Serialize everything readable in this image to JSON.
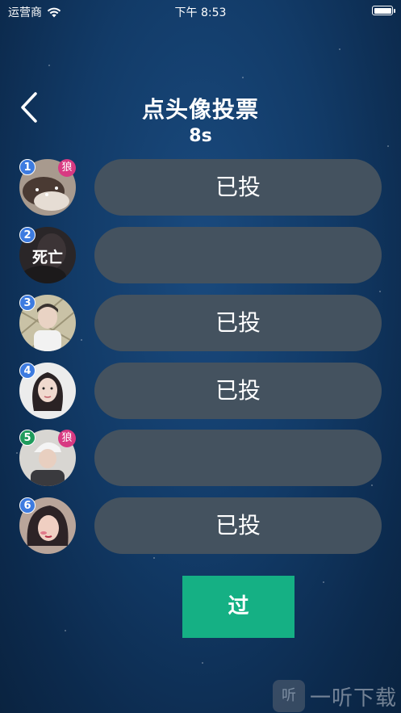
{
  "status_bar": {
    "carrier": "运营商",
    "time": "下午 8:53"
  },
  "header": {
    "title": "点头像投票",
    "timer": "8s"
  },
  "players": [
    {
      "number": "1",
      "badge_color": "#3d7be0",
      "role": "狼",
      "dead_text": "",
      "vote_label": "已投"
    },
    {
      "number": "2",
      "badge_color": "#3d7be0",
      "role": "",
      "dead_text": "死亡",
      "vote_label": ""
    },
    {
      "number": "3",
      "badge_color": "#3d7be0",
      "role": "",
      "dead_text": "",
      "vote_label": "已投"
    },
    {
      "number": "4",
      "badge_color": "#3d7be0",
      "role": "",
      "dead_text": "",
      "vote_label": "已投"
    },
    {
      "number": "5",
      "badge_color": "#1e9b5c",
      "role": "狼",
      "dead_text": "",
      "vote_label": ""
    },
    {
      "number": "6",
      "badge_color": "#3d7be0",
      "role": "",
      "dead_text": "",
      "vote_label": "已投"
    }
  ],
  "pass_button": {
    "label": "过"
  },
  "watermark": {
    "icon_label": "听",
    "text": "一听下载"
  },
  "colors": {
    "vote_button": "#44525f",
    "pass_button": "#15b084",
    "wolf_badge": "#d83a82"
  }
}
